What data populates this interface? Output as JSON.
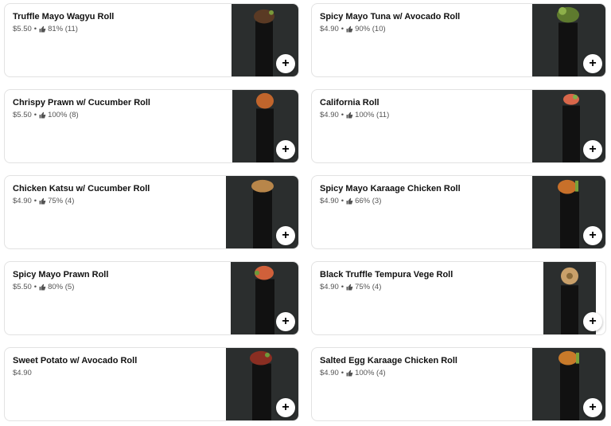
{
  "colors": {
    "card_border": "#e2e2e2",
    "photo_bg": "#2b2e2e",
    "meta_text": "#545454"
  },
  "icons": {
    "rating": "thumbs-up-icon",
    "add": "plus-icon"
  },
  "items": [
    {
      "name": "Truffle Mayo Wagyu Roll",
      "price": "$5.50",
      "rating": "81% (11)"
    },
    {
      "name": "Spicy Mayo Tuna w/ Avocado Roll",
      "price": "$4.90",
      "rating": "90% (10)"
    },
    {
      "name": "Chrispy Prawn w/ Cucumber Roll",
      "price": "$5.50",
      "rating": "100% (8)"
    },
    {
      "name": "California Roll",
      "price": "$4.90",
      "rating": "100% (11)"
    },
    {
      "name": "Chicken Katsu w/ Cucumber Roll",
      "price": "$4.90",
      "rating": "75% (4)"
    },
    {
      "name": "Spicy Mayo Karaage Chicken Roll",
      "price": "$4.90",
      "rating": "66% (3)"
    },
    {
      "name": "Spicy Mayo Prawn Roll",
      "price": "$5.50",
      "rating": "80% (5)"
    },
    {
      "name": "Black Truffle Tempura Vege Roll",
      "price": "$4.90",
      "rating": "75% (4)"
    },
    {
      "name": "Sweet Potato w/ Avocado Roll",
      "price": "$4.90",
      "rating": ""
    },
    {
      "name": "Salted Egg Karaage Chicken Roll",
      "price": "$4.90",
      "rating": "100% (4)"
    }
  ],
  "add_label": "+"
}
